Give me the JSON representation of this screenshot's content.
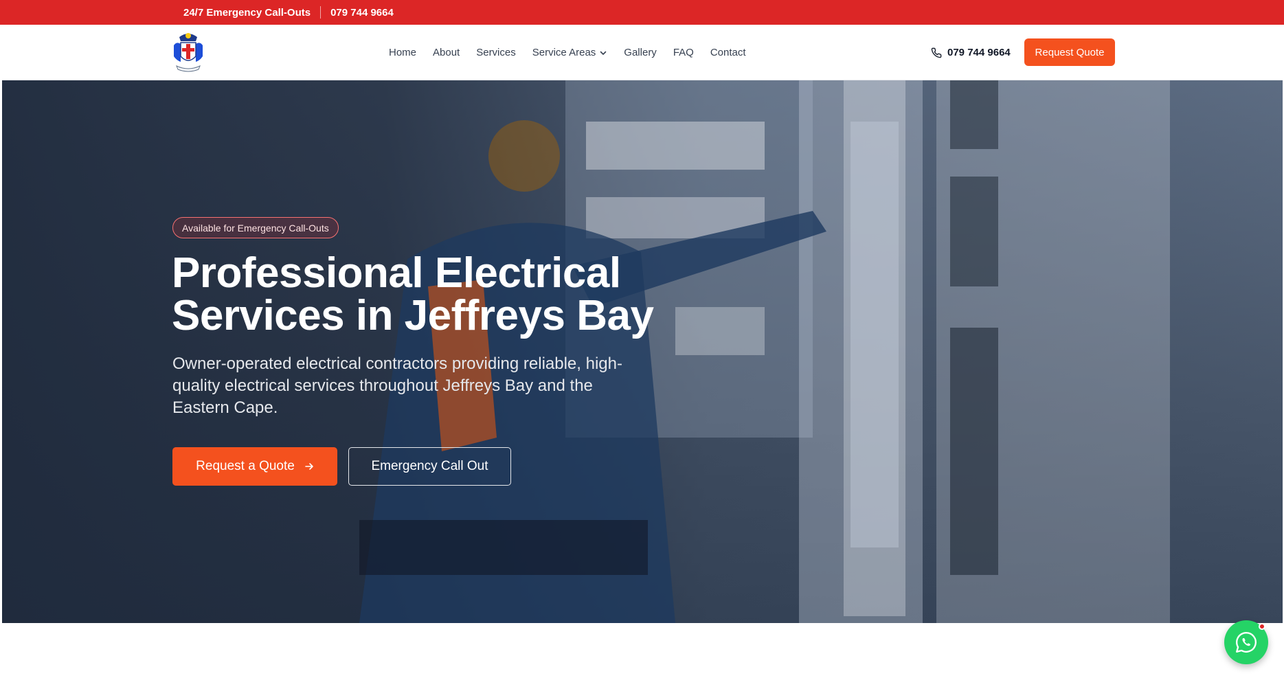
{
  "topbar": {
    "emergency_text": "24/7 Emergency Call-Outs",
    "phone": "079 744 9664"
  },
  "header": {
    "nav": [
      {
        "label": "Home"
      },
      {
        "label": "About"
      },
      {
        "label": "Services"
      },
      {
        "label": "Service Areas"
      },
      {
        "label": "Gallery"
      },
      {
        "label": "FAQ"
      },
      {
        "label": "Contact"
      }
    ],
    "phone": "079 744 9664",
    "quote_label": "Request Quote"
  },
  "hero": {
    "badge": "Available for Emergency Call-Outs",
    "title_line1": "Professional Electrical",
    "title_line2": "Services in Jeffreys Bay",
    "subtitle": "Owner-operated electrical contractors providing reliable, high-quality electrical services throughout Jeffreys Bay and the Eastern Cape.",
    "primary_button": "Request a Quote",
    "secondary_button": "Emergency Call Out"
  },
  "colors": {
    "brand_red": "#dc2626",
    "accent_orange": "#f4511e",
    "whatsapp_green": "#25d366"
  }
}
